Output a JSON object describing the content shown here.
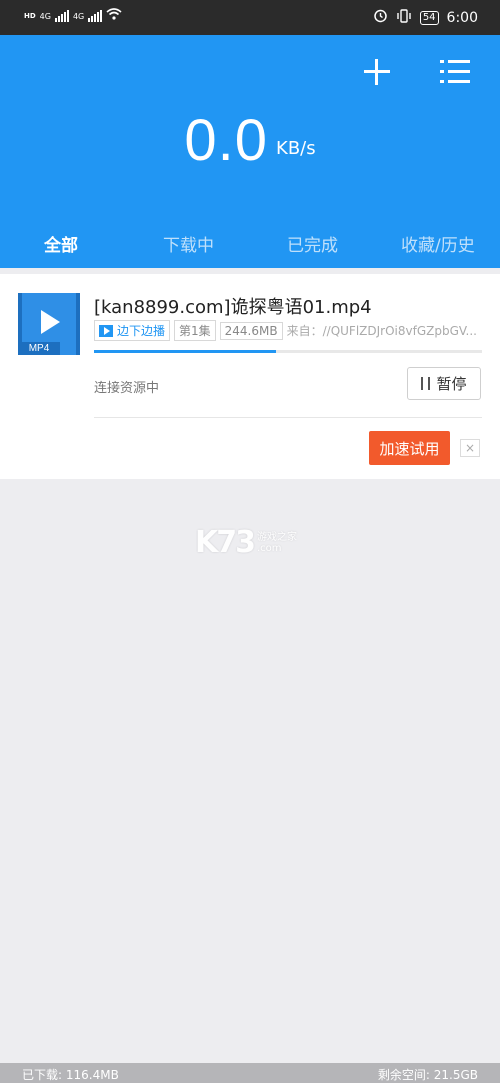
{
  "status_bar": {
    "network1": "4G",
    "network2": "4G",
    "hd": "HD",
    "battery": "54",
    "time": "6:00"
  },
  "header": {
    "speed_value": "0.0",
    "speed_unit": "KB/s",
    "tabs": [
      "全部",
      "下载中",
      "已完成",
      "收藏/历史"
    ],
    "active_tab": "全部",
    "accent_color": "#2196f3"
  },
  "task": {
    "icon_label": "MP4",
    "title": "[kan8899.com]诡探粤语01.mp4",
    "play_tag": "边下边播",
    "episode": "第1集",
    "size": "244.6MB",
    "source": "来自：//QUFlZDJrOi8vfGZpbGV...",
    "progress": 0.47,
    "status": "连接资源中",
    "pause_label": "暂停",
    "accelerate_label": "加速试用",
    "close_label": "×"
  },
  "watermark": {
    "main": "K73",
    "sub1": "游戏之家",
    "sub2": ".com"
  },
  "footer": {
    "downloaded": "已下载: 116.4MB",
    "free_space": "剩余空间: 21.5GB"
  }
}
